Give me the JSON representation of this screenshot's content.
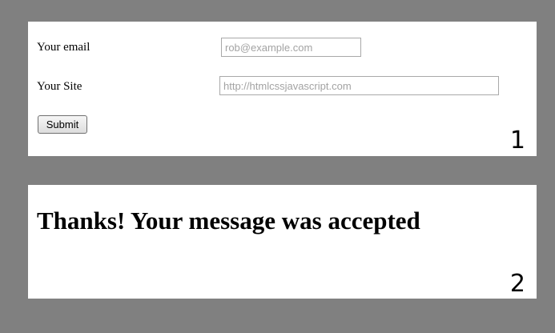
{
  "form_panel": {
    "email_label": "Your email",
    "email_placeholder": "rob@example.com",
    "site_label": "Your Site",
    "site_placeholder": "http://htmlcssjavascript.com",
    "submit_label": "Submit",
    "number": "1"
  },
  "confirmation_panel": {
    "message": "Thanks! Your message was accepted",
    "number": "2"
  },
  "colors": {
    "background": "#808080",
    "panel": "#ffffff"
  }
}
